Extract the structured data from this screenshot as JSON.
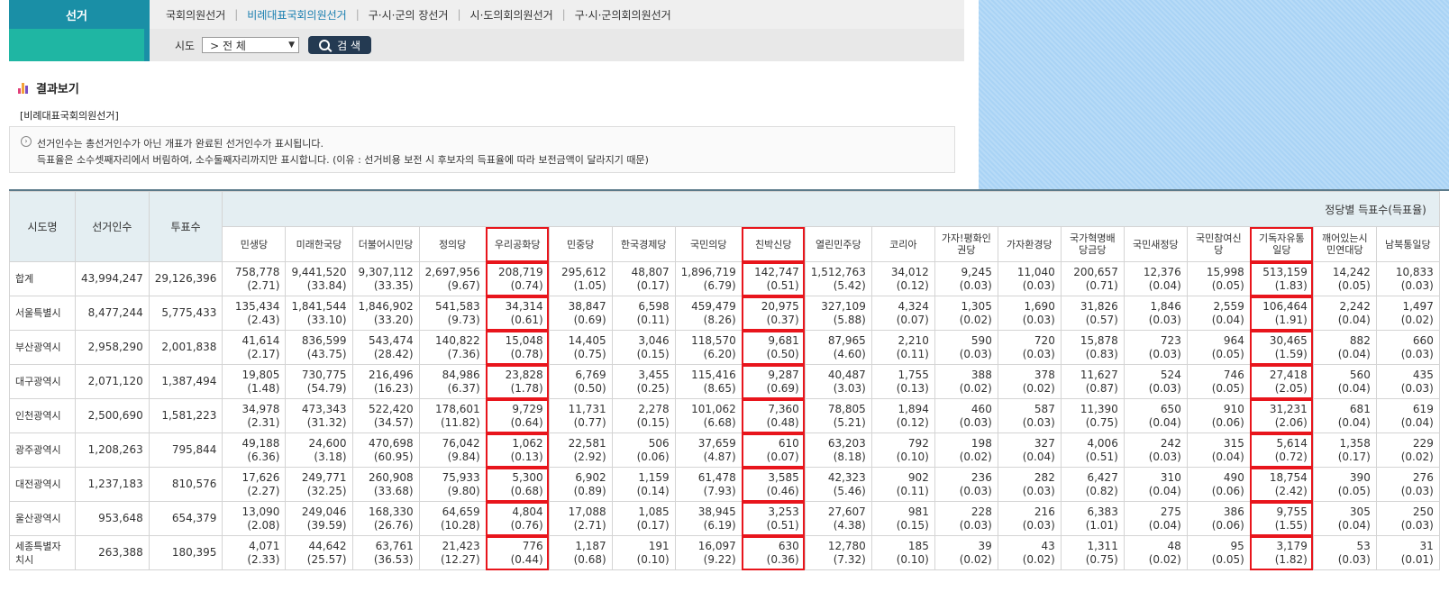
{
  "sidebar": {
    "title": "선거"
  },
  "nav": {
    "items": [
      "국회의원선거",
      "비례대표국회의원선거",
      "구·시·군의 장선거",
      "시·도의회의원선거",
      "구·시·군의회의원선거"
    ]
  },
  "search": {
    "label": "시도",
    "select_value": "> 전 체",
    "button": "검 색"
  },
  "result": {
    "heading": "결과보기",
    "subtitle": "[비례대표국회의원선거]",
    "notice1": "선거인수는 총선거인수가 아닌 개표가 완료된 선거인수가 표시됩니다.",
    "notice2": "득표율은 소수셋째자리에서 버림하여, 소수둘째자리까지만 표시합니다. (이유 : 선거비용 보전 시 후보자의 득표율에 따라 보전금액이 달라지기 때문)"
  },
  "table": {
    "headers": {
      "region": "시도명",
      "electors": "선거인수",
      "votes": "투표수",
      "party_group": "정당별 득표수(득표율)"
    },
    "parties": [
      "민생당",
      "미래한국당",
      "더불어시민당",
      "정의당",
      "우리공화당",
      "민중당",
      "한국경제당",
      "국민의당",
      "친박신당",
      "열린민주당",
      "코리아",
      "가자!평화인권당",
      "가자환경당",
      "국가혁명배당금당",
      "국민새정당",
      "국민참여신당",
      "기독자유통일당",
      "깨어있는시민연대당",
      "남북통일당"
    ],
    "rows": [
      {
        "name": "합계",
        "electors": "43,994,247",
        "votes": "29,126,396",
        "cells": [
          [
            "758,778",
            "(2.71)"
          ],
          [
            "9,441,520",
            "(33.84)"
          ],
          [
            "9,307,112",
            "(33.35)"
          ],
          [
            "2,697,956",
            "(9.67)"
          ],
          [
            "208,719",
            "(0.74)"
          ],
          [
            "295,612",
            "(1.05)"
          ],
          [
            "48,807",
            "(0.17)"
          ],
          [
            "1,896,719",
            "(6.79)"
          ],
          [
            "142,747",
            "(0.51)"
          ],
          [
            "1,512,763",
            "(5.42)"
          ],
          [
            "34,012",
            "(0.12)"
          ],
          [
            "9,245",
            "(0.03)"
          ],
          [
            "11,040",
            "(0.03)"
          ],
          [
            "200,657",
            "(0.71)"
          ],
          [
            "12,376",
            "(0.04)"
          ],
          [
            "15,998",
            "(0.05)"
          ],
          [
            "513,159",
            "(1.83)"
          ],
          [
            "14,242",
            "(0.05)"
          ],
          [
            "10,833",
            "(0.03)"
          ]
        ]
      },
      {
        "name": "서울특별시",
        "electors": "8,477,244",
        "votes": "5,775,433",
        "cells": [
          [
            "135,434",
            "(2.43)"
          ],
          [
            "1,841,544",
            "(33.10)"
          ],
          [
            "1,846,902",
            "(33.20)"
          ],
          [
            "541,583",
            "(9.73)"
          ],
          [
            "34,314",
            "(0.61)"
          ],
          [
            "38,847",
            "(0.69)"
          ],
          [
            "6,598",
            "(0.11)"
          ],
          [
            "459,479",
            "(8.26)"
          ],
          [
            "20,975",
            "(0.37)"
          ],
          [
            "327,109",
            "(5.88)"
          ],
          [
            "4,324",
            "(0.07)"
          ],
          [
            "1,305",
            "(0.02)"
          ],
          [
            "1,690",
            "(0.03)"
          ],
          [
            "31,826",
            "(0.57)"
          ],
          [
            "1,846",
            "(0.03)"
          ],
          [
            "2,559",
            "(0.04)"
          ],
          [
            "106,464",
            "(1.91)"
          ],
          [
            "2,242",
            "(0.04)"
          ],
          [
            "1,497",
            "(0.02)"
          ]
        ]
      },
      {
        "name": "부산광역시",
        "electors": "2,958,290",
        "votes": "2,001,838",
        "cells": [
          [
            "41,614",
            "(2.17)"
          ],
          [
            "836,599",
            "(43.75)"
          ],
          [
            "543,474",
            "(28.42)"
          ],
          [
            "140,822",
            "(7.36)"
          ],
          [
            "15,048",
            "(0.78)"
          ],
          [
            "14,405",
            "(0.75)"
          ],
          [
            "3,046",
            "(0.15)"
          ],
          [
            "118,570",
            "(6.20)"
          ],
          [
            "9,681",
            "(0.50)"
          ],
          [
            "87,965",
            "(4.60)"
          ],
          [
            "2,210",
            "(0.11)"
          ],
          [
            "590",
            "(0.03)"
          ],
          [
            "720",
            "(0.03)"
          ],
          [
            "15,878",
            "(0.83)"
          ],
          [
            "723",
            "(0.03)"
          ],
          [
            "964",
            "(0.05)"
          ],
          [
            "30,465",
            "(1.59)"
          ],
          [
            "882",
            "(0.04)"
          ],
          [
            "660",
            "(0.03)"
          ]
        ]
      },
      {
        "name": "대구광역시",
        "electors": "2,071,120",
        "votes": "1,387,494",
        "cells": [
          [
            "19,805",
            "(1.48)"
          ],
          [
            "730,775",
            "(54.79)"
          ],
          [
            "216,496",
            "(16.23)"
          ],
          [
            "84,986",
            "(6.37)"
          ],
          [
            "23,828",
            "(1.78)"
          ],
          [
            "6,769",
            "(0.50)"
          ],
          [
            "3,455",
            "(0.25)"
          ],
          [
            "115,416",
            "(8.65)"
          ],
          [
            "9,287",
            "(0.69)"
          ],
          [
            "40,487",
            "(3.03)"
          ],
          [
            "1,755",
            "(0.13)"
          ],
          [
            "388",
            "(0.02)"
          ],
          [
            "378",
            "(0.02)"
          ],
          [
            "11,627",
            "(0.87)"
          ],
          [
            "524",
            "(0.03)"
          ],
          [
            "746",
            "(0.05)"
          ],
          [
            "27,418",
            "(2.05)"
          ],
          [
            "560",
            "(0.04)"
          ],
          [
            "435",
            "(0.03)"
          ]
        ]
      },
      {
        "name": "인천광역시",
        "electors": "2,500,690",
        "votes": "1,581,223",
        "cells": [
          [
            "34,978",
            "(2.31)"
          ],
          [
            "473,343",
            "(31.32)"
          ],
          [
            "522,420",
            "(34.57)"
          ],
          [
            "178,601",
            "(11.82)"
          ],
          [
            "9,729",
            "(0.64)"
          ],
          [
            "11,731",
            "(0.77)"
          ],
          [
            "2,278",
            "(0.15)"
          ],
          [
            "101,062",
            "(6.68)"
          ],
          [
            "7,360",
            "(0.48)"
          ],
          [
            "78,805",
            "(5.21)"
          ],
          [
            "1,894",
            "(0.12)"
          ],
          [
            "460",
            "(0.03)"
          ],
          [
            "587",
            "(0.03)"
          ],
          [
            "11,390",
            "(0.75)"
          ],
          [
            "650",
            "(0.04)"
          ],
          [
            "910",
            "(0.06)"
          ],
          [
            "31,231",
            "(2.06)"
          ],
          [
            "681",
            "(0.04)"
          ],
          [
            "619",
            "(0.04)"
          ]
        ]
      },
      {
        "name": "광주광역시",
        "electors": "1,208,263",
        "votes": "795,844",
        "cells": [
          [
            "49,188",
            "(6.36)"
          ],
          [
            "24,600",
            "(3.18)"
          ],
          [
            "470,698",
            "(60.95)"
          ],
          [
            "76,042",
            "(9.84)"
          ],
          [
            "1,062",
            "(0.13)"
          ],
          [
            "22,581",
            "(2.92)"
          ],
          [
            "506",
            "(0.06)"
          ],
          [
            "37,659",
            "(4.87)"
          ],
          [
            "610",
            "(0.07)"
          ],
          [
            "63,203",
            "(8.18)"
          ],
          [
            "792",
            "(0.10)"
          ],
          [
            "198",
            "(0.02)"
          ],
          [
            "327",
            "(0.04)"
          ],
          [
            "4,006",
            "(0.51)"
          ],
          [
            "242",
            "(0.03)"
          ],
          [
            "315",
            "(0.04)"
          ],
          [
            "5,614",
            "(0.72)"
          ],
          [
            "1,358",
            "(0.17)"
          ],
          [
            "229",
            "(0.02)"
          ]
        ]
      },
      {
        "name": "대전광역시",
        "electors": "1,237,183",
        "votes": "810,576",
        "cells": [
          [
            "17,626",
            "(2.27)"
          ],
          [
            "249,771",
            "(32.25)"
          ],
          [
            "260,908",
            "(33.68)"
          ],
          [
            "75,933",
            "(9.80)"
          ],
          [
            "5,300",
            "(0.68)"
          ],
          [
            "6,902",
            "(0.89)"
          ],
          [
            "1,159",
            "(0.14)"
          ],
          [
            "61,478",
            "(7.93)"
          ],
          [
            "3,585",
            "(0.46)"
          ],
          [
            "42,323",
            "(5.46)"
          ],
          [
            "902",
            "(0.11)"
          ],
          [
            "236",
            "(0.03)"
          ],
          [
            "282",
            "(0.03)"
          ],
          [
            "6,427",
            "(0.82)"
          ],
          [
            "310",
            "(0.04)"
          ],
          [
            "490",
            "(0.06)"
          ],
          [
            "18,754",
            "(2.42)"
          ],
          [
            "390",
            "(0.05)"
          ],
          [
            "276",
            "(0.03)"
          ]
        ]
      },
      {
        "name": "울산광역시",
        "electors": "953,648",
        "votes": "654,379",
        "cells": [
          [
            "13,090",
            "(2.08)"
          ],
          [
            "249,046",
            "(39.59)"
          ],
          [
            "168,330",
            "(26.76)"
          ],
          [
            "64,659",
            "(10.28)"
          ],
          [
            "4,804",
            "(0.76)"
          ],
          [
            "17,088",
            "(2.71)"
          ],
          [
            "1,085",
            "(0.17)"
          ],
          [
            "38,945",
            "(6.19)"
          ],
          [
            "3,253",
            "(0.51)"
          ],
          [
            "27,607",
            "(4.38)"
          ],
          [
            "981",
            "(0.15)"
          ],
          [
            "228",
            "(0.03)"
          ],
          [
            "216",
            "(0.03)"
          ],
          [
            "6,383",
            "(1.01)"
          ],
          [
            "275",
            "(0.04)"
          ],
          [
            "386",
            "(0.06)"
          ],
          [
            "9,755",
            "(1.55)"
          ],
          [
            "305",
            "(0.04)"
          ],
          [
            "250",
            "(0.03)"
          ]
        ]
      },
      {
        "name": "세종특별자치시",
        "electors": "263,388",
        "votes": "180,395",
        "cells": [
          [
            "4,071",
            "(2.33)"
          ],
          [
            "44,642",
            "(25.57)"
          ],
          [
            "63,761",
            "(36.53)"
          ],
          [
            "21,423",
            "(12.27)"
          ],
          [
            "776",
            "(0.44)"
          ],
          [
            "1,187",
            "(0.68)"
          ],
          [
            "191",
            "(0.10)"
          ],
          [
            "16,097",
            "(9.22)"
          ],
          [
            "630",
            "(0.36)"
          ],
          [
            "12,780",
            "(7.32)"
          ],
          [
            "185",
            "(0.10)"
          ],
          [
            "39",
            "(0.02)"
          ],
          [
            "43",
            "(0.02)"
          ],
          [
            "1,311",
            "(0.75)"
          ],
          [
            "48",
            "(0.02)"
          ],
          [
            "95",
            "(0.05)"
          ],
          [
            "3,179",
            "(1.82)"
          ],
          [
            "53",
            "(0.03)"
          ],
          [
            "31",
            "(0.01)"
          ]
        ]
      }
    ]
  }
}
